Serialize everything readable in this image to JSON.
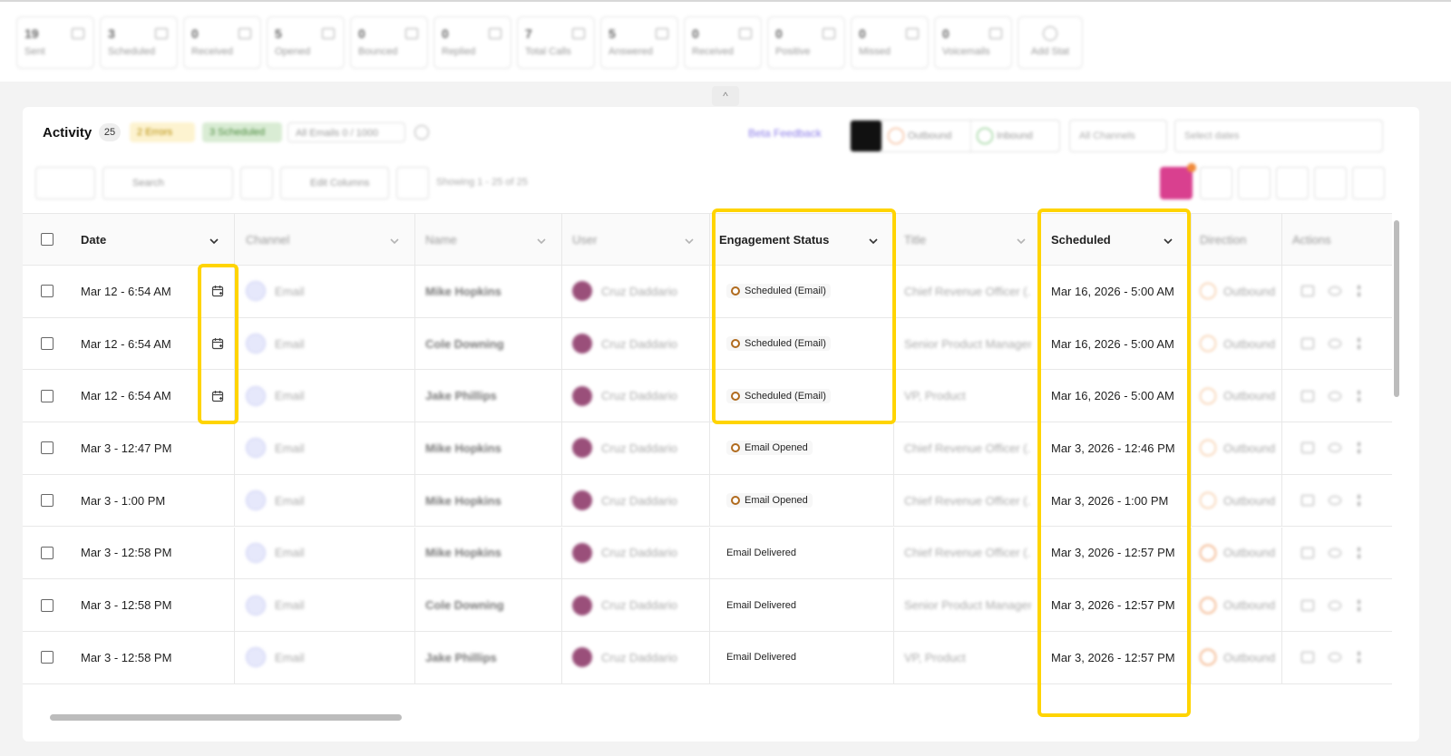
{
  "stats": [
    {
      "value": "19",
      "label": "Sent"
    },
    {
      "value": "3",
      "label": "Scheduled"
    },
    {
      "value": "0",
      "label": "Received"
    },
    {
      "value": "5",
      "label": "Opened"
    },
    {
      "value": "0",
      "label": "Bounced"
    },
    {
      "value": "0",
      "label": "Replied"
    },
    {
      "value": "7",
      "label": "Total Calls"
    },
    {
      "value": "5",
      "label": "Answered"
    },
    {
      "value": "0",
      "label": "Received"
    },
    {
      "value": "0",
      "label": "Positive"
    },
    {
      "value": "0",
      "label": "Missed"
    },
    {
      "value": "0",
      "label": "Voicemails"
    }
  ],
  "add_stat_label": "Add Stat",
  "collapse_glyph": "^",
  "activity": {
    "title": "Activity",
    "count": "25",
    "pill_yellow": "2 Errors",
    "pill_green": "3 Scheduled",
    "pill_grey": "All Emails 0 / 1000",
    "beta_feedback": "Beta Feedback",
    "outbound": "Outbound",
    "inbound": "Inbound",
    "channels_placeholder": "All Channels",
    "dates_placeholder": "Select dates"
  },
  "toolbar": {
    "search_placeholder": "Search",
    "edit_columns": "Edit Columns",
    "showing": "Showing 1 - 25 of 25"
  },
  "columns": {
    "date": "Date",
    "channel": "Channel",
    "name": "Name",
    "user": "User",
    "engagement": "Engagement Status",
    "title": "Title",
    "scheduled": "Scheduled",
    "direction": "Direction",
    "actions": "Actions"
  },
  "rows": [
    {
      "date": "Mar 12 - 6:54 AM",
      "cal": true,
      "channel": "Email",
      "name": "Mike Hopkins",
      "user": "Cruz Daddario",
      "status": "Scheduled (Email)",
      "status_dot": true,
      "title": "Chief Revenue Officer (...",
      "scheduled": "Mar 16, 2026 - 5:00 AM",
      "direction": "Outbound"
    },
    {
      "date": "Mar 12 - 6:54 AM",
      "cal": true,
      "channel": "Email",
      "name": "Cole Downing",
      "user": "Cruz Daddario",
      "status": "Scheduled (Email)",
      "status_dot": true,
      "title": "Senior Product Manager",
      "scheduled": "Mar 16, 2026 - 5:00 AM",
      "direction": "Outbound"
    },
    {
      "date": "Mar 12 - 6:54 AM",
      "cal": true,
      "channel": "Email",
      "name": "Jake Phillips",
      "user": "Cruz Daddario",
      "status": "Scheduled (Email)",
      "status_dot": true,
      "title": "VP, Product",
      "scheduled": "Mar 16, 2026 - 5:00 AM",
      "direction": "Outbound"
    },
    {
      "date": "Mar 3 - 12:47 PM",
      "cal": false,
      "channel": "Email",
      "name": "Mike Hopkins",
      "user": "Cruz Daddario",
      "status": "Email Opened",
      "status_dot": true,
      "title": "Chief Revenue Officer (...",
      "scheduled": "Mar 3, 2026 - 12:46 PM",
      "direction": "Outbound"
    },
    {
      "date": "Mar 3 - 1:00 PM",
      "cal": false,
      "channel": "Email",
      "name": "Mike Hopkins",
      "user": "Cruz Daddario",
      "status": "Email Opened",
      "status_dot": true,
      "title": "Chief Revenue Officer (...",
      "scheduled": "Mar 3, 2026 - 1:00 PM",
      "direction": "Outbound"
    },
    {
      "date": "Mar 3 - 12:58 PM",
      "cal": false,
      "channel": "Email",
      "name": "Mike Hopkins",
      "user": "Cruz Daddario",
      "status": "Email Delivered",
      "status_dot": false,
      "title": "Chief Revenue Officer (...",
      "scheduled": "Mar 3, 2026 - 12:57 PM",
      "direction": "Outbound"
    },
    {
      "date": "Mar 3 - 12:58 PM",
      "cal": false,
      "channel": "Email",
      "name": "Cole Downing",
      "user": "Cruz Daddario",
      "status": "Email Delivered",
      "status_dot": false,
      "title": "Senior Product Manager",
      "scheduled": "Mar 3, 2026 - 12:57 PM",
      "direction": "Outbound"
    },
    {
      "date": "Mar 3 - 12:58 PM",
      "cal": false,
      "channel": "Email",
      "name": "Jake Phillips",
      "user": "Cruz Daddario",
      "status": "Email Delivered",
      "status_dot": false,
      "title": "VP, Product",
      "scheduled": "Mar 3, 2026 - 12:57 PM",
      "direction": "Outbound"
    }
  ],
  "colors": {
    "highlight": "#ffd400",
    "status_ring": "#b06b1e",
    "pink_button": "#d9408f"
  }
}
